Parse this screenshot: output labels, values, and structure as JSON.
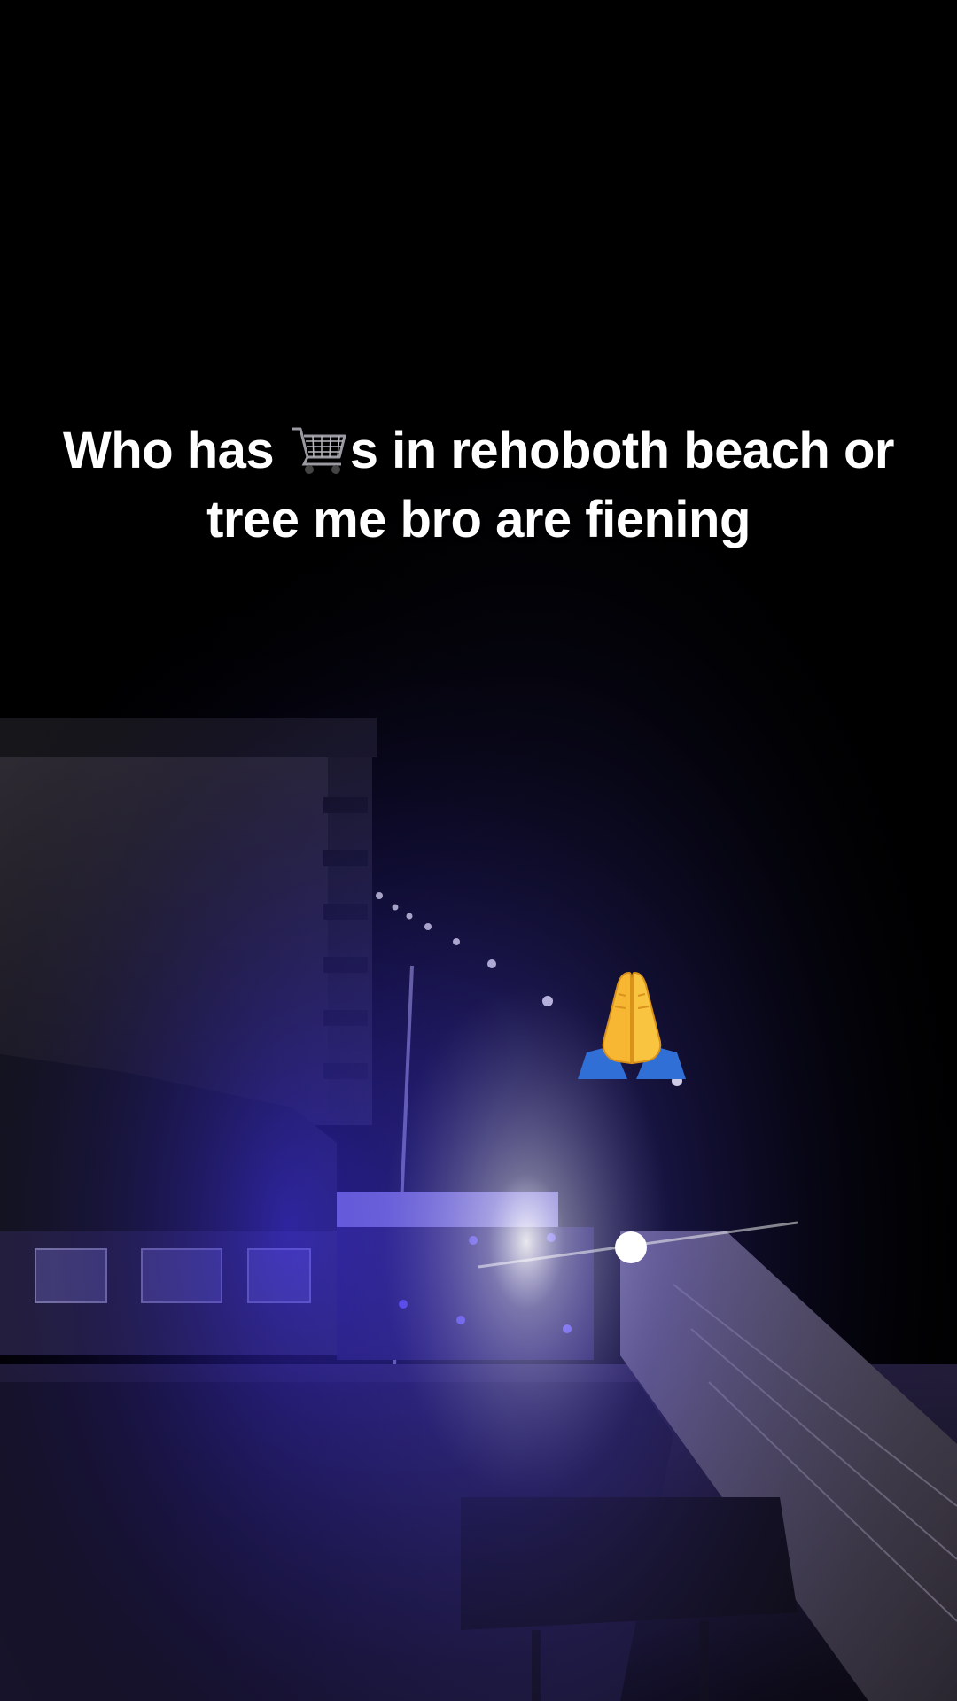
{
  "caption": {
    "part1": "Who has ",
    "cart_icon": "shopping-cart-emoji",
    "part2": "s in rehoboth beach or",
    "line2": "tree me bro are fiening"
  },
  "sticker": {
    "icon": "folded-hands-emoji"
  },
  "colors": {
    "background": "#000000",
    "caption_text": "#ffffff",
    "light_accent": "#3a2cff"
  }
}
